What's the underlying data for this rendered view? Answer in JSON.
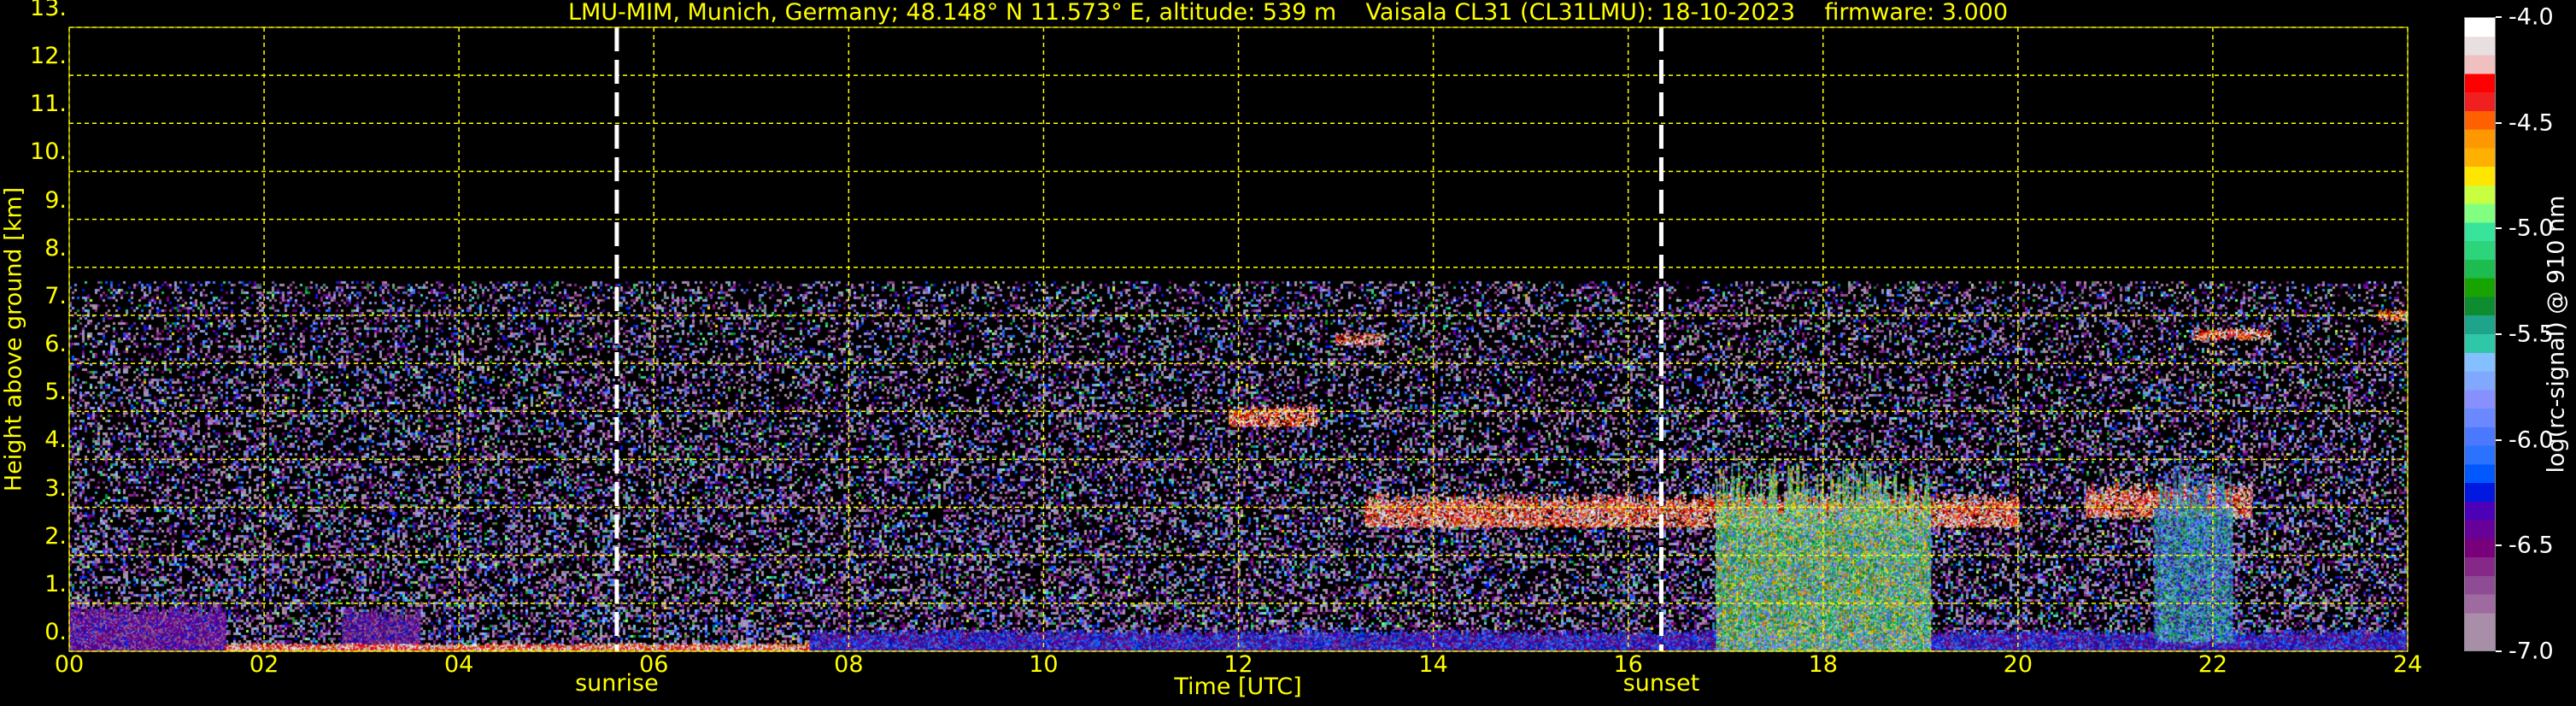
{
  "chart_data": {
    "type": "heatmap",
    "title": "LMU-MIM, Munich, Germany; 48.148° N 11.573° E, altitude: 539 m    Vaisala CL31 (CL31LMU): 18-10-2023    firmware: 3.000",
    "xlabel": "Time [UTC]",
    "ylabel": "Height above ground [km]",
    "xlim": [
      0,
      24
    ],
    "ylim": [
      0,
      13
    ],
    "x_ticks": [
      "00",
      "02",
      "04",
      "06",
      "08",
      "10",
      "12",
      "14",
      "16",
      "18",
      "20",
      "22",
      "24"
    ],
    "y_ticks": [
      "0.",
      "1.",
      "2.",
      "3.",
      "4.",
      "5.",
      "6.",
      "7.",
      "8.",
      "9.",
      "10.",
      "11.",
      "12.",
      "13."
    ],
    "grid": true,
    "annotations": [
      {
        "label": "sunrise",
        "x": 5.62
      },
      {
        "label": "sunset",
        "x": 16.34
      }
    ],
    "colorbar": {
      "label": "log(rc-signal) @ 910 nm",
      "range": [
        -7.0,
        -4.0
      ],
      "ticks": [
        "-4.0",
        "-4.5",
        "-5.0",
        "-5.5",
        "-6.0",
        "-6.5",
        "-7.0"
      ],
      "colors_low_to_high": [
        "#a78fa8",
        "#a88ea8",
        "#9e6aa0",
        "#8e4c94",
        "#862888",
        "#78007a",
        "#68009a",
        "#4c00b8",
        "#0018e0",
        "#0058ff",
        "#2a72ff",
        "#4a78ff",
        "#6a88ff",
        "#8890ff",
        "#80a8ff",
        "#84c0ff",
        "#2ec8a8",
        "#1ea48a",
        "#0e8c30",
        "#18a400",
        "#1cbc50",
        "#2cd47c",
        "#38e49c",
        "#80ff80",
        "#c8ff40",
        "#ffe600",
        "#ffb000",
        "#ff9800",
        "#ff6000",
        "#f02020",
        "#ff0000",
        "#f0c0c0",
        "#e8e0e0",
        "#ffffff"
      ]
    },
    "noise_top_km": 7.7,
    "features": [
      {
        "type": "boundary_layer",
        "x": [
          0,
          1.6
        ],
        "top_km": 0.9,
        "value": -6.5
      },
      {
        "type": "boundary_layer",
        "x": [
          2.8,
          3.6
        ],
        "top_km": 0.8,
        "value": -6.5
      },
      {
        "type": "surface_fog",
        "x": [
          1.6,
          7.6
        ],
        "top_km": 0.15,
        "value": -4.0
      },
      {
        "type": "surface_layer",
        "x": [
          7.6,
          24
        ],
        "top_km": 0.4,
        "value": -6.0
      },
      {
        "type": "cloud",
        "x": [
          11.9,
          12.8
        ],
        "base_km": 4.7,
        "top_km": 5.1,
        "value": -4.0
      },
      {
        "type": "cloud",
        "x": [
          13.0,
          13.5
        ],
        "base_km": 6.4,
        "top_km": 6.6,
        "value": -4.0
      },
      {
        "type": "cloud",
        "x": [
          13.3,
          20.0
        ],
        "base_km": 2.6,
        "top_km": 3.2,
        "value": -4.0
      },
      {
        "type": "precipitation",
        "x": [
          16.9,
          19.1
        ],
        "base_km": 0.0,
        "top_km": 3.3,
        "value": -4.5
      },
      {
        "type": "cloud",
        "x": [
          20.7,
          22.4
        ],
        "base_km": 2.8,
        "top_km": 3.4,
        "value": -4.0
      },
      {
        "type": "precipitation",
        "x": [
          21.4,
          22.2
        ],
        "base_km": 0.2,
        "top_km": 3.4,
        "value": -5.0
      },
      {
        "type": "cloud",
        "x": [
          21.8,
          22.6
        ],
        "base_km": 6.5,
        "top_km": 6.7,
        "value": -4.0
      },
      {
        "type": "cloud",
        "x": [
          23.7,
          24
        ],
        "base_km": 6.9,
        "top_km": 7.1,
        "value": -4.0
      }
    ]
  }
}
